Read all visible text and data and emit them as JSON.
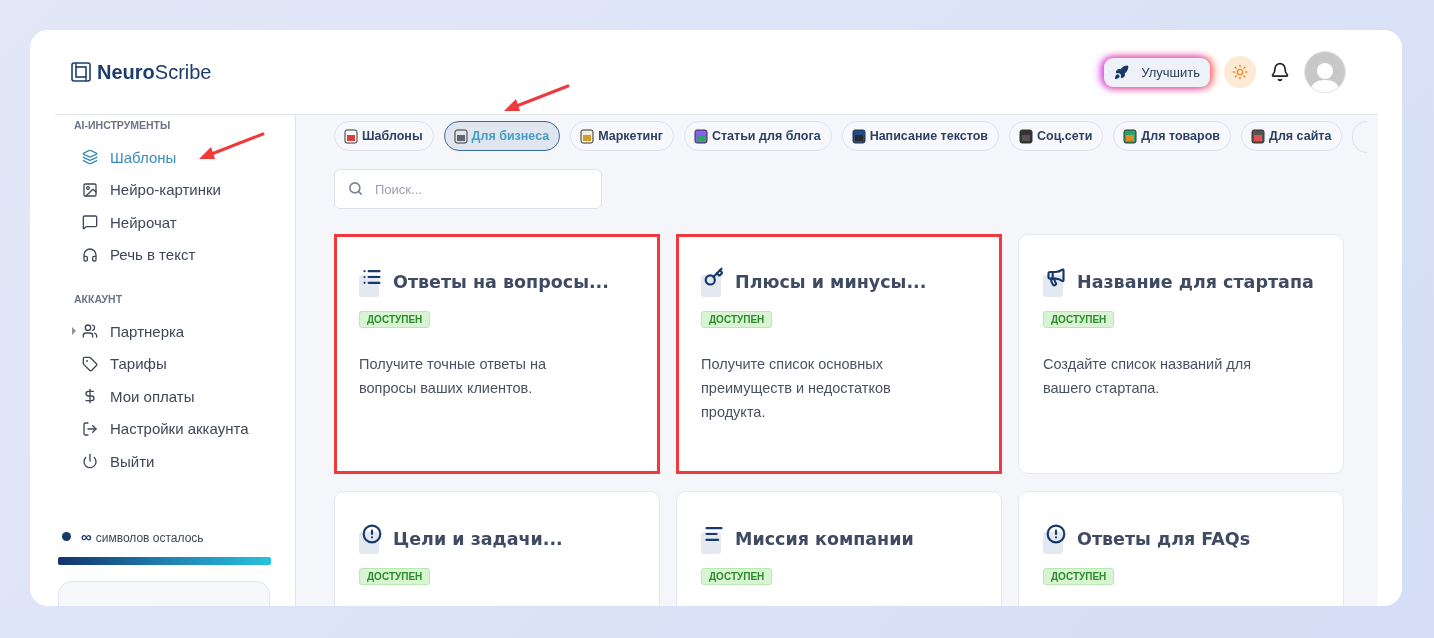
{
  "brand": {
    "bold": "Neuro",
    "light": "Scribe"
  },
  "header": {
    "upgrade_button": "Улучшить"
  },
  "sidebar": {
    "sections": [
      {
        "title": "AI-ИНСТРУМЕНТЫ",
        "items": [
          {
            "label": "Шаблоны",
            "selected": true,
            "pointer": true,
            "expandable": false
          },
          {
            "label": "Нейро-картинки",
            "selected": false,
            "pointer": false,
            "expandable": false
          },
          {
            "label": "Нейрочат",
            "selected": false,
            "pointer": false,
            "expandable": false
          },
          {
            "label": "Речь в текст",
            "selected": false,
            "pointer": false,
            "expandable": false
          }
        ]
      },
      {
        "title": "АККАУНТ",
        "items": [
          {
            "label": "Партнерка",
            "selected": false,
            "pointer": false,
            "expandable": true
          },
          {
            "label": "Тарифы",
            "selected": false,
            "pointer": false,
            "expandable": false
          },
          {
            "label": "Мои оплаты",
            "selected": false,
            "pointer": false,
            "expandable": false
          },
          {
            "label": "Настройки аккаунта",
            "selected": false,
            "pointer": false,
            "expandable": false
          },
          {
            "label": "Выйти",
            "selected": false,
            "pointer": false,
            "expandable": false
          }
        ]
      }
    ],
    "symbols": {
      "count": "∞",
      "label": "символов осталось",
      "level": 1
    }
  },
  "tabs": [
    {
      "label": "Шаблоны",
      "selected": false,
      "pointer": false
    },
    {
      "label": "Для бизнеса",
      "selected": true,
      "pointer": true
    },
    {
      "label": "Маркетинг",
      "selected": false,
      "pointer": false
    },
    {
      "label": "Статьи для блога",
      "selected": false,
      "pointer": false
    },
    {
      "label": "Написание текстов",
      "selected": false,
      "pointer": false
    },
    {
      "label": "Соц.сети",
      "selected": false,
      "pointer": false
    },
    {
      "label": "Для товаров",
      "selected": false,
      "pointer": false
    },
    {
      "label": "Для сайта",
      "selected": false,
      "pointer": false
    }
  ],
  "search": {
    "placeholder": "Поиск..."
  },
  "cards": [
    {
      "title": "Ответы на вопросы...",
      "badge": "ДОСТУПЕН",
      "description": "Получите точные ответы на вопросы ваших клиентов.",
      "highlighted": true
    },
    {
      "title": "Плюсы и минусы...",
      "badge": "ДОСТУПЕН",
      "description": "Получите список основных преимуществ и недостатков продукта.",
      "highlighted": true
    },
    {
      "title": "Название для стартапа",
      "badge": "ДОСТУПЕН",
      "description": "Создайте список названий для вашего стартапа.",
      "highlighted": false
    },
    {
      "title": "Цели и задачи...",
      "badge": "ДОСТУПЕН",
      "highlighted": false
    },
    {
      "title": "Миссия компании",
      "badge": "ДОСТУПЕН",
      "highlighted": false
    },
    {
      "title": "Ответы для FAQs",
      "badge": "ДОСТУПЕН",
      "highlighted": false
    }
  ]
}
